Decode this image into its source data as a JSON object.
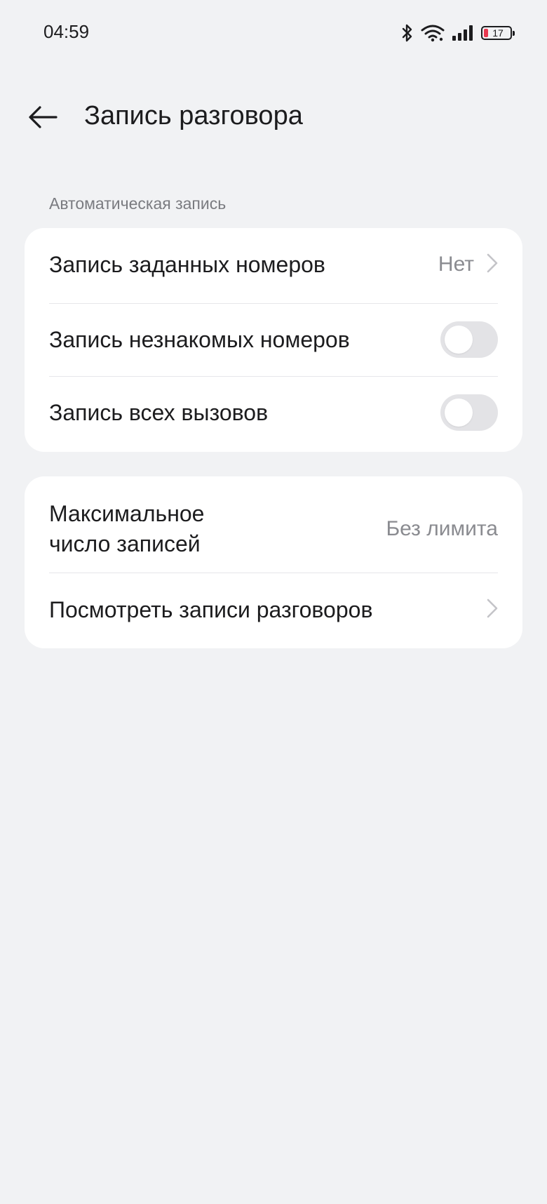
{
  "status_bar": {
    "time": "04:59",
    "battery_level": "17",
    "battery_color": "#e8384f"
  },
  "header": {
    "back_icon": "arrow-left-icon",
    "title": "Запись разговора"
  },
  "section": {
    "label": "Автоматическая запись"
  },
  "auto_record": {
    "items": [
      {
        "label": "Запись заданных номеров",
        "value": "Нет",
        "control": "chevron-right-icon"
      },
      {
        "label": "Запись незнакомых номеров",
        "control": "toggle",
        "enabled": false
      },
      {
        "label": "Запись всех вызовов",
        "control": "toggle",
        "enabled": false
      }
    ]
  },
  "records": {
    "items": [
      {
        "label_line1": "Максимальное",
        "label_line2": "число записей",
        "value": "Без лимита"
      },
      {
        "label": "Посмотреть записи разговоров",
        "control": "chevron-right-icon"
      }
    ]
  },
  "colors": {
    "background": "#f1f2f4",
    "card": "#ffffff",
    "toggle_off": "#e3e3e6",
    "secondary_text": "#8a8b90"
  }
}
